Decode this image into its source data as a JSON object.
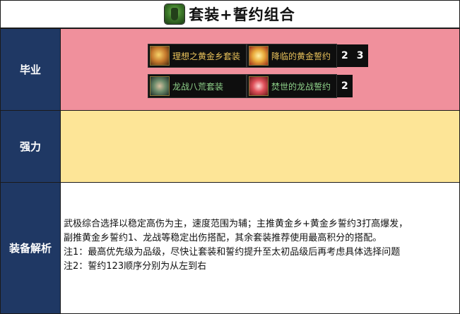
{
  "title": {
    "icon": "green-armor-icon",
    "text": "套装+誓约组合"
  },
  "rows": {
    "biye": {
      "label": "毕业",
      "combos": [
        {
          "suit": {
            "name": "理想之黄金乡套装",
            "icon": "golden-beast-icon",
            "color": "#e8c15a"
          },
          "oath": {
            "name": "降临的黄金誓约",
            "icon": "golden-crest-icon",
            "color": "#e8c15a"
          },
          "ranks": [
            "2",
            "3"
          ]
        },
        {
          "suit": {
            "name": "龙战八荒套装",
            "icon": "dragon-icon",
            "color": "#8fd28a"
          },
          "oath": {
            "name": "焚世的龙战誓约",
            "icon": "red-orb-icon",
            "color": "#8fd28a"
          },
          "ranks": [
            "2"
          ]
        }
      ]
    },
    "qiangli": {
      "label": "强力"
    },
    "jiexi": {
      "label": "装备解析",
      "lines": [
        "武极综合选择以稳定高伤为主，速度范围为辅；主推黄金乡+黄金乡誓约3打高爆发，",
        "副推黄金乡誓约1、龙战等稳定出伤搭配，其余套装推荐使用最高积分的搭配。",
        "注1：最高优先级为品级，尽快让套装和誓约提升至太初品级后再考虑具体选择问题",
        "注2：誓约123顺序分别为从左到右"
      ]
    }
  },
  "colors": {
    "label_bg": "#1f3864",
    "biye_bg": "#f0909c",
    "qiangli_bg": "#fde597",
    "item_bg": "#0e0e0e"
  }
}
